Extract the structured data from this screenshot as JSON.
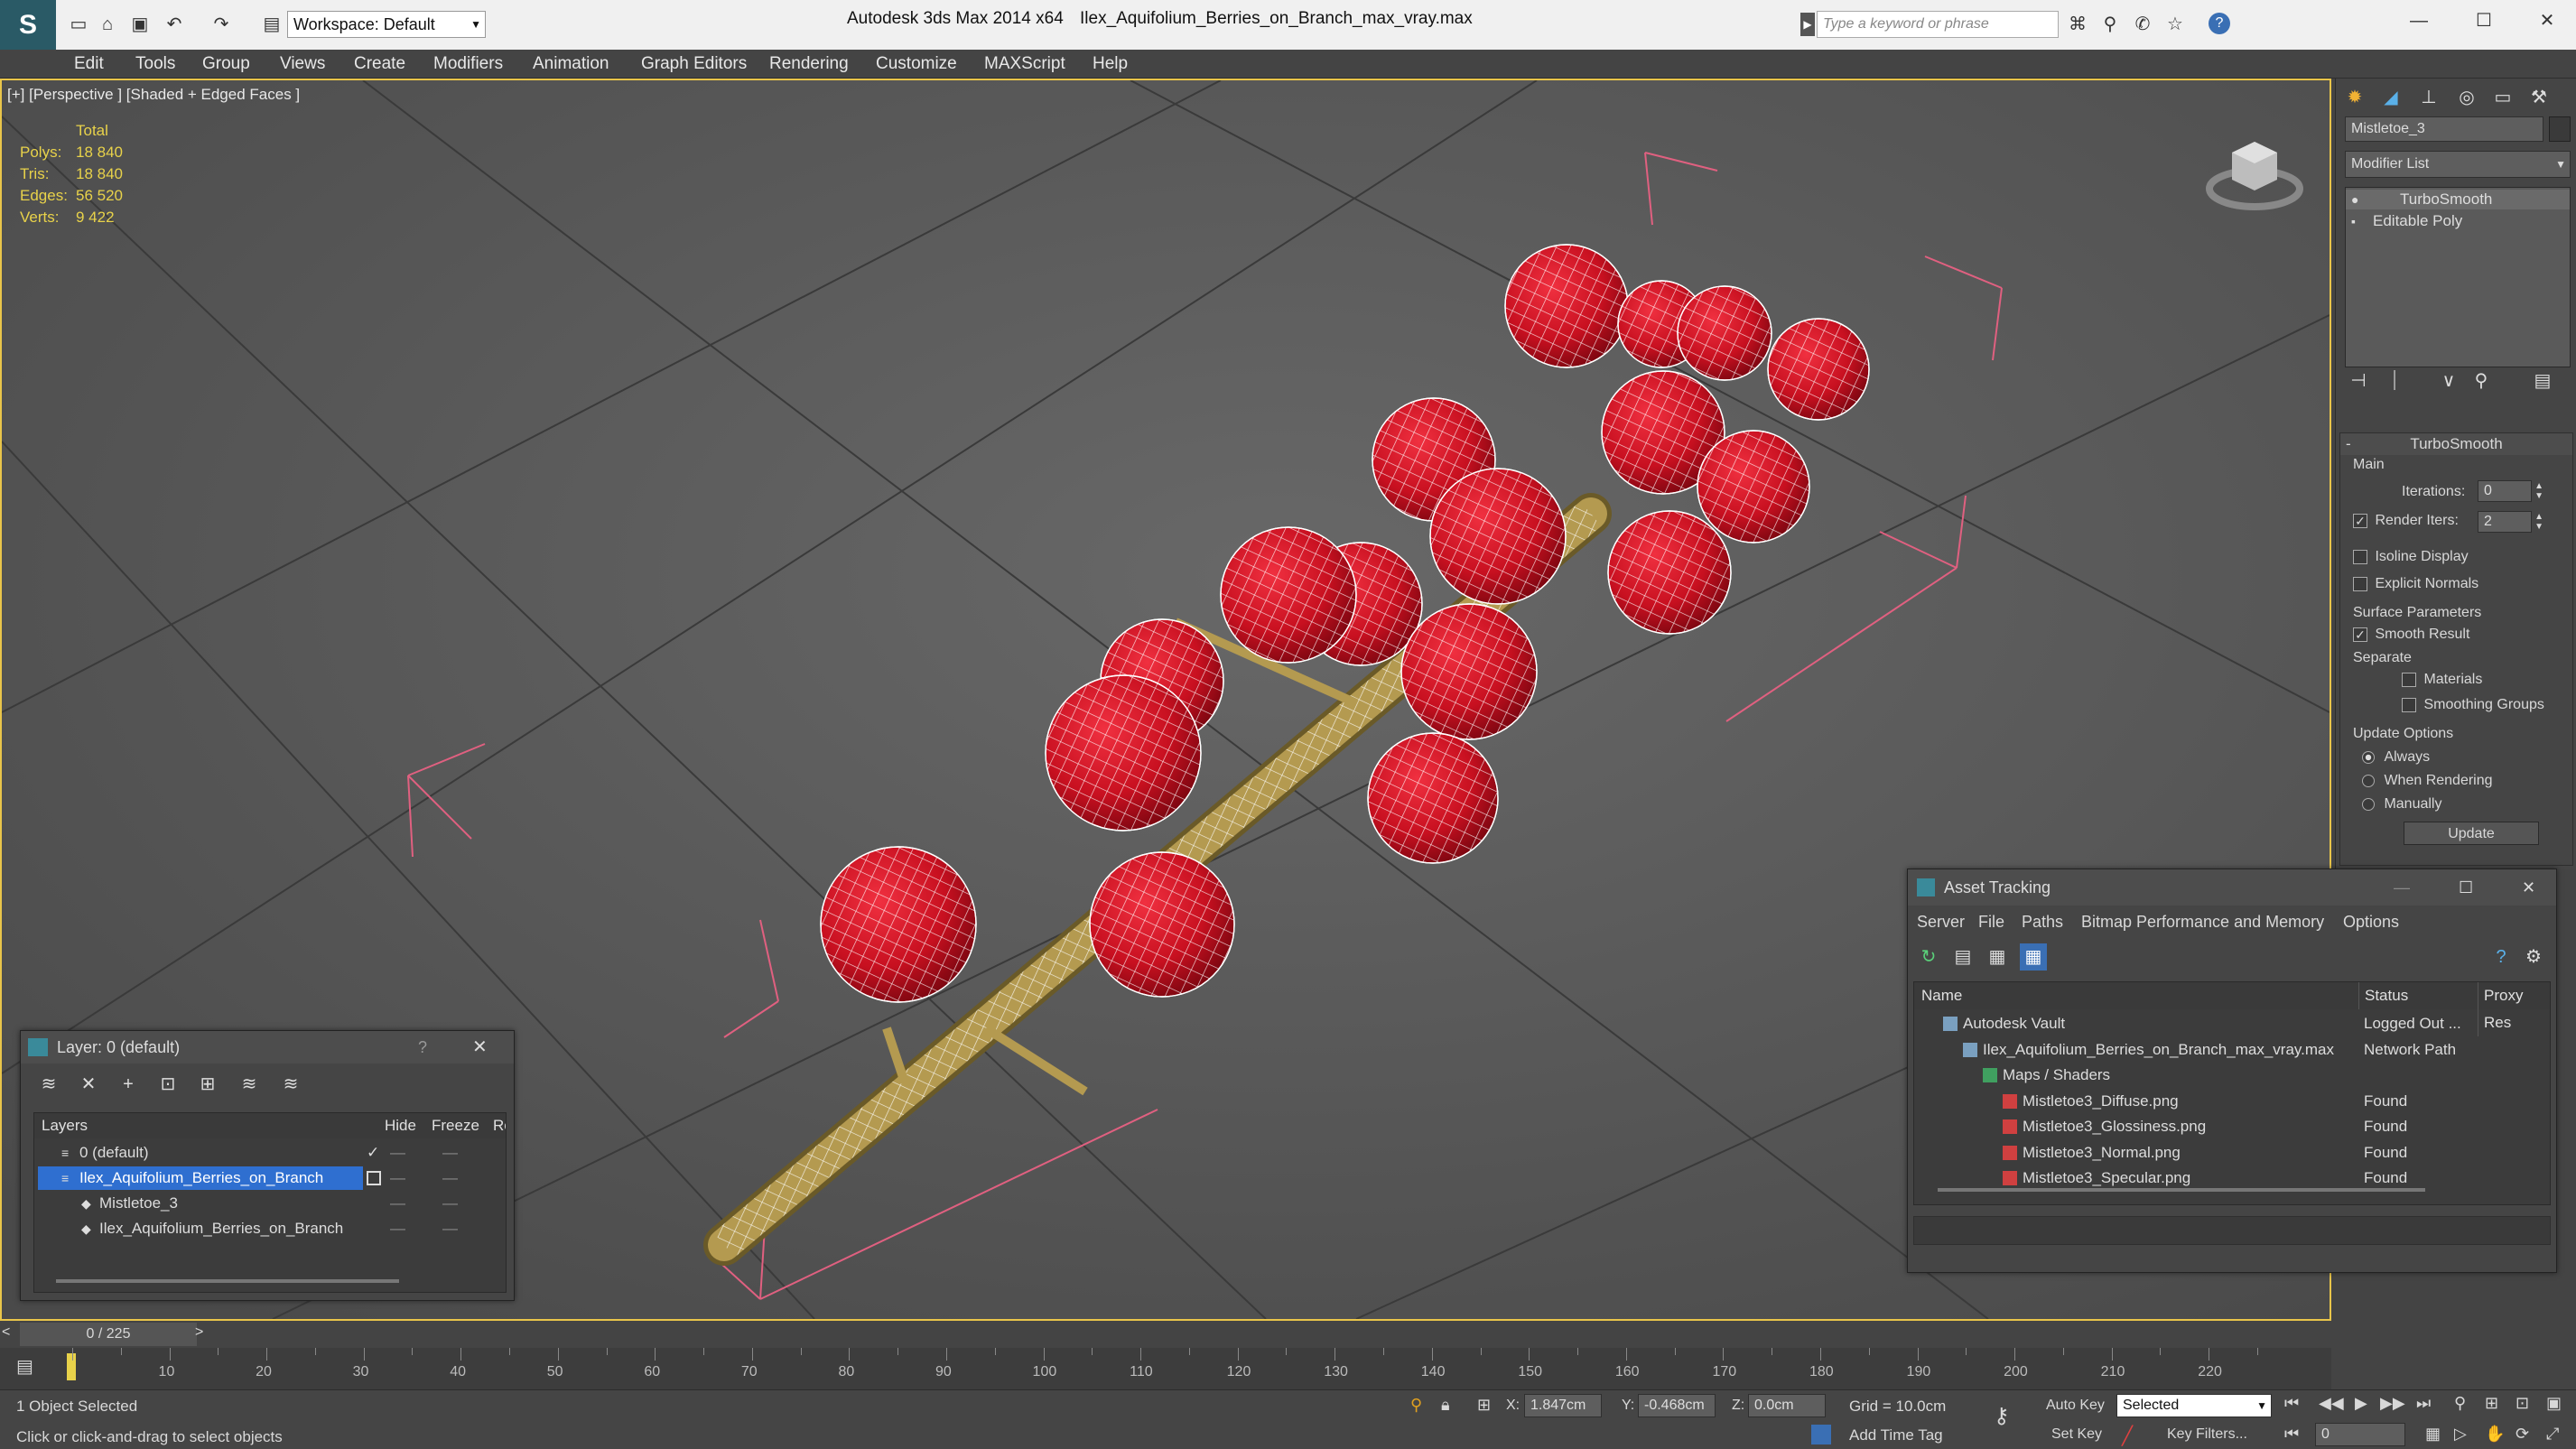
{
  "app": {
    "workspace": "Workspace: Default",
    "title_app": "Autodesk 3ds Max  2014 x64",
    "title_file": "Ilex_Aquifolium_Berries_on_Branch_max_vray.max",
    "search_placeholder": "Type a keyword or phrase"
  },
  "menu": [
    "Edit",
    "Tools",
    "Group",
    "Views",
    "Create",
    "Modifiers",
    "Animation",
    "Graph Editors",
    "Rendering",
    "Customize",
    "MAXScript",
    "Help"
  ],
  "viewport": {
    "label": "[+] [Perspective ] [Shaded + Edged Faces ]",
    "stats_header": "Total",
    "stats": [
      {
        "label": "Polys:",
        "value": "18 840"
      },
      {
        "label": "Tris:",
        "value": "18 840"
      },
      {
        "label": "Edges:",
        "value": "56 520"
      },
      {
        "label": "Verts:",
        "value": "9 422"
      }
    ]
  },
  "command_panel": {
    "object_name": "Mistletoe_3",
    "modifier_list": "Modifier List",
    "stack": [
      "TurboSmooth",
      "Editable Poly"
    ],
    "rollout_title": "TurboSmooth",
    "main_label": "Main",
    "iterations_label": "Iterations:",
    "iterations_value": "0",
    "render_iters_label": "Render Iters:",
    "render_iters_value": "2",
    "isoline_label": "Isoline Display",
    "explicit_normals_label": "Explicit Normals",
    "surface_params_label": "Surface Parameters",
    "smooth_result_label": "Smooth Result",
    "separate_label": "Separate",
    "materials_label": "Materials",
    "smoothing_groups_label": "Smoothing Groups",
    "update_options_label": "Update Options",
    "always_label": "Always",
    "when_rendering_label": "When Rendering",
    "manually_label": "Manually",
    "update_button": "Update"
  },
  "layer_window": {
    "title": "Layer: 0 (default)",
    "help": "?",
    "col_layers": "Layers",
    "col_hide": "Hide",
    "col_freeze": "Freeze",
    "col_render": "Re",
    "rows": [
      {
        "name": "0 (default)",
        "indent": 1,
        "selected": false
      },
      {
        "name": "Ilex_Aquifolium_Berries_on_Branch",
        "indent": 1,
        "selected": true
      },
      {
        "name": "Mistletoe_3",
        "indent": 2,
        "selected": false
      },
      {
        "name": "Ilex_Aquifolium_Berries_on_Branch",
        "indent": 2,
        "selected": false
      }
    ]
  },
  "asset_window": {
    "title": "Asset Tracking",
    "menu": [
      "Server",
      "File",
      "Paths",
      "Bitmap Performance and Memory",
      "Options"
    ],
    "col_name": "Name",
    "col_status": "Status",
    "col_proxy": "Proxy Res",
    "rows": [
      {
        "name": "Autodesk Vault",
        "status": "Logged Out ...",
        "indent": 1,
        "icon": "vault-icon"
      },
      {
        "name": "Ilex_Aquifolium_Berries_on_Branch_max_vray.max",
        "status": "Network Path",
        "indent": 2,
        "icon": "max-file-icon"
      },
      {
        "name": "Maps / Shaders",
        "status": "",
        "indent": 3,
        "icon": "maps-icon"
      },
      {
        "name": "Mistletoe3_Diffuse.png",
        "status": "Found",
        "indent": 4,
        "icon": "png-icon"
      },
      {
        "name": "Mistletoe3_Glossiness.png",
        "status": "Found",
        "indent": 4,
        "icon": "png-icon"
      },
      {
        "name": "Mistletoe3_Normal.png",
        "status": "Found",
        "indent": 4,
        "icon": "png-icon"
      },
      {
        "name": "Mistletoe3_Specular.png",
        "status": "Found",
        "indent": 4,
        "icon": "png-icon"
      }
    ]
  },
  "timeline": {
    "frame": "0 / 225",
    "ticks": [
      "10",
      "20",
      "30",
      "40",
      "50",
      "60",
      "70",
      "80",
      "90",
      "100",
      "110",
      "120",
      "130",
      "140",
      "150",
      "160",
      "170",
      "180",
      "190",
      "200",
      "210",
      "220"
    ]
  },
  "status": {
    "selected": "1 Object Selected",
    "prompt": "Click or click-and-drag to select objects",
    "x_label": "X:",
    "x_value": "1.847cm",
    "y_label": "Y:",
    "y_value": "-0.468cm",
    "z_label": "Z:",
    "z_value": "0.0cm",
    "grid": "Grid = 10.0cm",
    "add_time_tag": "Add Time Tag",
    "auto_key": "Auto Key",
    "set_key": "Set Key",
    "key_mode": "Selected",
    "key_filters": "Key Filters...",
    "current_frame": "0"
  },
  "colors": {
    "viewport_bg": "#5f5f5f",
    "viewport_border": "#e9c54a",
    "stats_yellow": "#e8d24a",
    "berry_red": "#c81020",
    "branch": "#a08a44",
    "gizmo_pink": "#e06080",
    "selection_blue": "#2f6fd0"
  }
}
